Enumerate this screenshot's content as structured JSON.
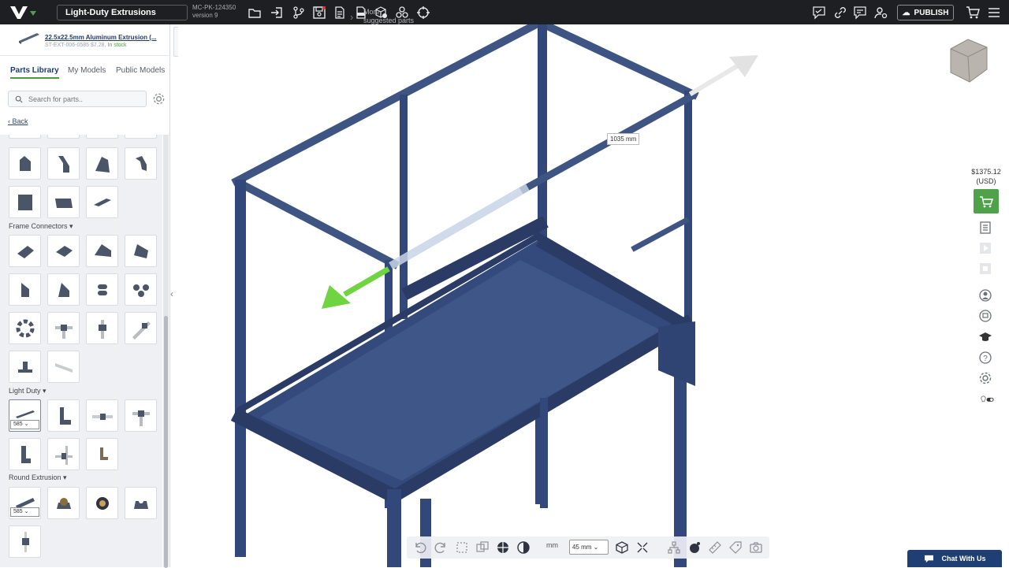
{
  "topbar": {
    "project_name": "Light-Duty Extrusions",
    "model_id": "MC-PK-124350",
    "version": "version 9",
    "publish_label": "PUBLISH"
  },
  "selected_part": {
    "name": "22.5x22.5mm Aluminum Extrusion (...",
    "sku": "ST-EXT-006-0585",
    "price": "$7.28,",
    "stock": "In stock"
  },
  "tabs": [
    {
      "label": "Parts Library",
      "active": true
    },
    {
      "label": "My Models",
      "active": false
    },
    {
      "label": "Public Models",
      "active": false
    }
  ],
  "search": {
    "placeholder": "Search for parts.."
  },
  "back_label": "Back",
  "categories": {
    "frame_connectors": "Frame Connectors",
    "light_duty": "Light Duty",
    "round_extrusion": "Round Extrusion"
  },
  "length_selects": {
    "light_duty": "585",
    "round_extrusion": "585"
  },
  "suggested": {
    "more_line1": "More",
    "more_line2": "suggested parts"
  },
  "viewport": {
    "dimension_label": "1035 mm"
  },
  "right_panel": {
    "price": "$1375.12",
    "currency": "(USD)"
  },
  "bottom_toolbar": {
    "grid_size": "45 mm",
    "unit_label": "mm"
  },
  "chat_label": "Chat With Us",
  "colors": {
    "topbar": "#1d1f22",
    "accent_green": "#4fa14a",
    "link_blue": "#1e3d72",
    "frame_blue": "#3e5583",
    "chat_blue": "#1f3f74"
  }
}
